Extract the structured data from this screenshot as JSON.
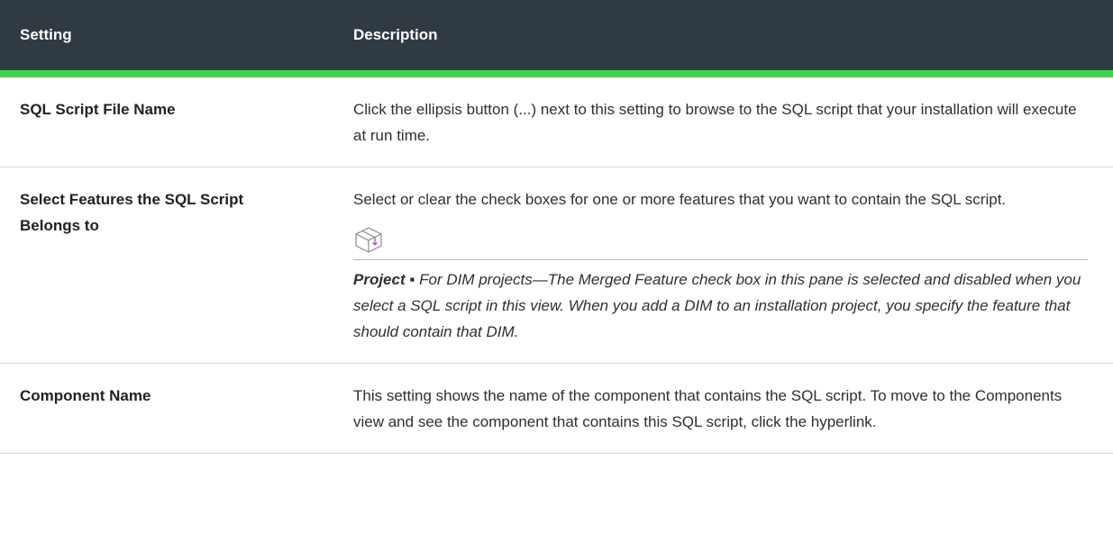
{
  "table": {
    "header": {
      "setting": "Setting",
      "description": "Description"
    },
    "rows": [
      {
        "name": "SQL Script File Name",
        "description": "Click the ellipsis button (...) next to this setting to browse to the SQL script that your installation will execute at run time."
      },
      {
        "name": "Select Features the SQL Script Belongs to",
        "description": "Select or clear the check boxes for one or more features that you want to contain the SQL script.",
        "note": {
          "icon": "box-icon",
          "label": "Project ▪",
          "text": "For DIM projects—The Merged Feature check box in this pane is selected and disabled when you select a SQL script in this view. When you add a DIM to an installation project, you specify the feature that should contain that DIM."
        }
      },
      {
        "name": "Component Name",
        "description": "This setting shows the name of the component that contains the SQL script. To move to the Components view and see the component that contains this SQL script, click the hyperlink."
      }
    ]
  },
  "colors": {
    "header_bg": "#2f3a43",
    "header_accent": "#3fd64e",
    "icon_accent": "#a64dd6"
  }
}
